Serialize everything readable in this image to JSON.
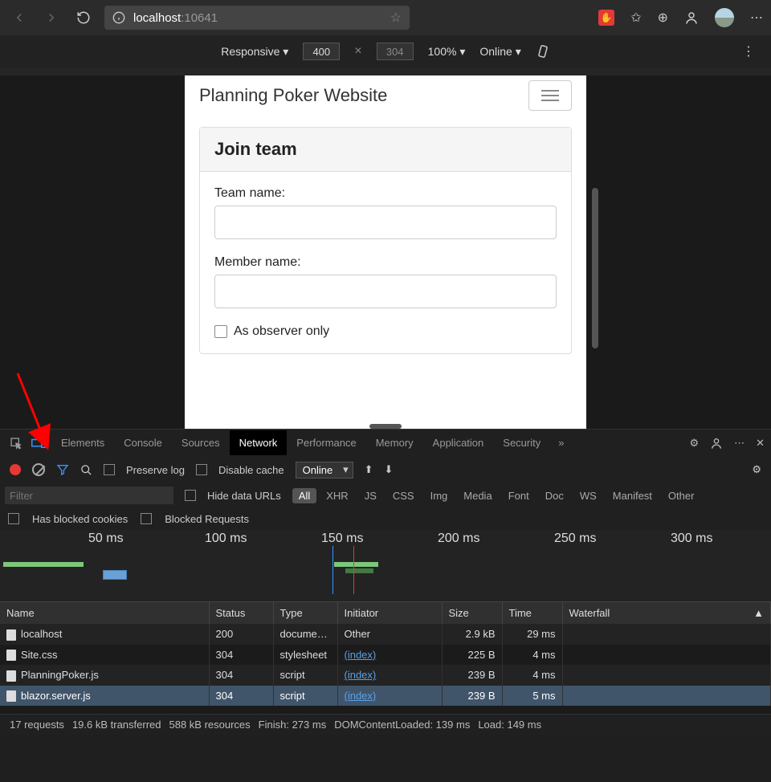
{
  "browser": {
    "url_host": "localhost",
    "url_port": ":10641"
  },
  "device_bar": {
    "mode": "Responsive ▾",
    "width": "400",
    "height": "304",
    "zoom": "100% ▾",
    "throttle": "Online ▾"
  },
  "mobile": {
    "title": "Planning Poker Website",
    "card_title": "Join team",
    "team_label": "Team name:",
    "member_label": "Member name:",
    "observer_label": "As observer only"
  },
  "devtools_tabs": [
    "Elements",
    "Console",
    "Sources",
    "Network",
    "Performance",
    "Memory",
    "Application",
    "Security"
  ],
  "network_bar": {
    "preserve": "Preserve log",
    "disable_cache": "Disable cache",
    "online": "Online"
  },
  "filters": {
    "placeholder": "Filter",
    "hide_data": "Hide data URLs",
    "types": [
      "All",
      "XHR",
      "JS",
      "CSS",
      "Img",
      "Media",
      "Font",
      "Doc",
      "WS",
      "Manifest",
      "Other"
    ],
    "blocked_cookies": "Has blocked cookies",
    "blocked_requests": "Blocked Requests"
  },
  "timeline_ticks": [
    "50 ms",
    "100 ms",
    "150 ms",
    "200 ms",
    "250 ms",
    "300 ms"
  ],
  "columns": [
    "Name",
    "Status",
    "Type",
    "Initiator",
    "Size",
    "Time",
    "Waterfall"
  ],
  "rows": [
    {
      "name": "localhost",
      "status": "200",
      "type": "docume…",
      "initiator": "Other",
      "initiator_link": false,
      "size": "2.9 kB",
      "time": "29 ms",
      "sel": false
    },
    {
      "name": "Site.css",
      "status": "304",
      "type": "stylesheet",
      "initiator": "(index)",
      "initiator_link": true,
      "size": "225 B",
      "time": "4 ms",
      "sel": false
    },
    {
      "name": "PlanningPoker.js",
      "status": "304",
      "type": "script",
      "initiator": "(index)",
      "initiator_link": true,
      "size": "239 B",
      "time": "4 ms",
      "sel": false
    },
    {
      "name": "blazor.server.js",
      "status": "304",
      "type": "script",
      "initiator": "(index)",
      "initiator_link": true,
      "size": "239 B",
      "time": "5 ms",
      "sel": true
    }
  ],
  "status": {
    "requests": "17 requests",
    "transferred": "19.6 kB transferred",
    "resources": "588 kB resources",
    "finish": "Finish: 273 ms",
    "dcl": "DOMContentLoaded: 139 ms",
    "load": "Load: 149 ms"
  }
}
